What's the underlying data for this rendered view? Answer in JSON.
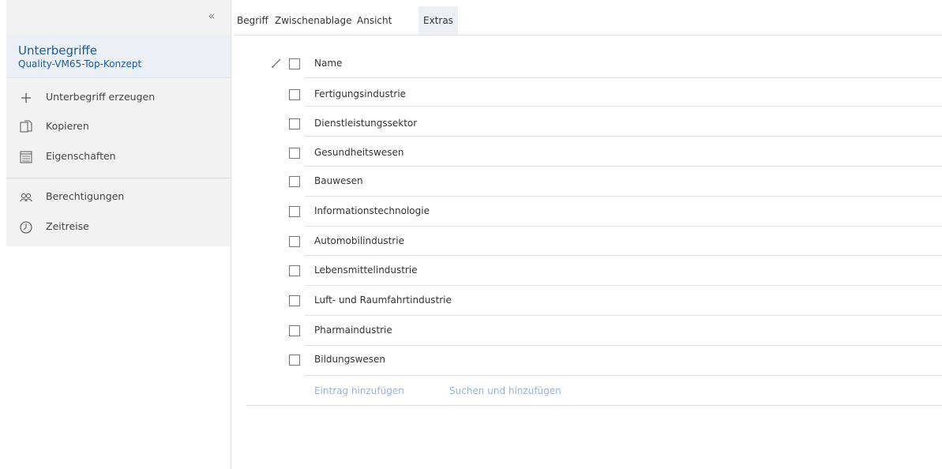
{
  "sidebar": {
    "collapse_icon": "«",
    "title": "Unterbegriffe",
    "subtitle": "Quality-VM65-Top-Konzept",
    "items": [
      {
        "label": "Unterbegriff erzeugen",
        "icon": "plus-icon"
      },
      {
        "label": "Kopieren",
        "icon": "copy-icon"
      },
      {
        "label": "Eigenschaften",
        "icon": "properties-icon"
      },
      {
        "label": "Berechtigungen",
        "icon": "users-icon"
      },
      {
        "label": "Zeitreise",
        "icon": "clock-icon"
      }
    ]
  },
  "menu": {
    "items": [
      "Begriff",
      "Zwischenablage",
      "Ansicht",
      "Extras"
    ],
    "active": "Extras"
  },
  "list": {
    "header": "Name",
    "rows": [
      "Fertigungsindustrie",
      "Dienstleistungssektor",
      "Gesundheitswesen",
      "Bauwesen",
      "Informationstechnologie",
      "Automobilindustrie",
      "Lebensmittelindustrie",
      "Luft- und Raumfahrtindustrie",
      "Pharmaindustrie",
      "Bildungswesen"
    ],
    "add_entry": "Eintrag hinzufügen",
    "search_add": "Suchen und hinzufügen"
  },
  "colors": {
    "accent": "#1d5a96",
    "link": "#9ab3cf",
    "sidebar_bg": "#f2f2f2",
    "header_bg": "#eaf0f6"
  }
}
